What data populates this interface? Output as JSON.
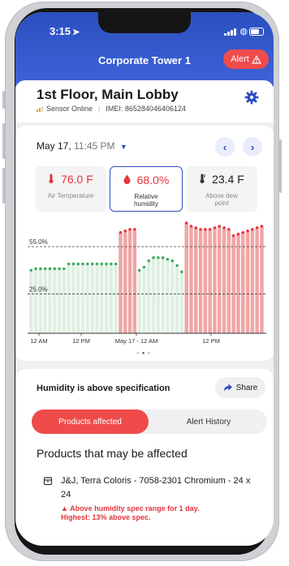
{
  "status_bar": {
    "time": "3:15"
  },
  "header": {
    "title": "Corporate Tower 1",
    "alert_label": "Alert"
  },
  "location": {
    "name": "1st Floor, Main Lobby",
    "sensor_status": "Sensor Online",
    "imei": "IMEI: 865284046406124"
  },
  "graph": {
    "date": "May 17,",
    "time": "11:45 PM",
    "metrics": [
      {
        "value": "76.0 F",
        "label": "Air Temperature",
        "icon": "thermometer-icon"
      },
      {
        "value": "68.0%",
        "label": "Relative humidity",
        "icon": "drop-icon"
      },
      {
        "value": "23.4 F",
        "label": "Above dew point",
        "icon": "thermometer-icon"
      }
    ],
    "colors": {
      "accent": "#2f4ec4",
      "alert": "#ef4b4b",
      "ok": "#3ba860"
    }
  },
  "chart_data": {
    "type": "bar",
    "reference_lines": [
      {
        "label": "55.0%",
        "value": 55
      },
      {
        "label": "25.0%",
        "value": 25
      }
    ],
    "x_tick_labels": [
      "12 AM",
      "12 PM",
      "May 17 - 12 AM",
      "12 PM"
    ],
    "ylim": [
      0,
      70
    ],
    "values": [
      40,
      41,
      41,
      41,
      41,
      41,
      41,
      41,
      44,
      44,
      44,
      44,
      44,
      44,
      44,
      44,
      44,
      44,
      44,
      64,
      65,
      66,
      66,
      40,
      42,
      46,
      48,
      48,
      48,
      47,
      46,
      43,
      39,
      70,
      68,
      67,
      66,
      66,
      66,
      67,
      68,
      67,
      66,
      62,
      63,
      64,
      65,
      66,
      67,
      68
    ],
    "threshold": 55
  },
  "bottom": {
    "spec_title": "Humidity is above specification",
    "share_label": "Share",
    "tabs": [
      "Products affected",
      "Alert History"
    ],
    "section_title": "Products that may be affected",
    "product": "J&J, Terra Coloris - 7058-2301 Chromium - 24 x 24",
    "warning_line1": "Above humidity spec range for 1 day.",
    "warning_line2": "Highest: 13% above spec."
  }
}
